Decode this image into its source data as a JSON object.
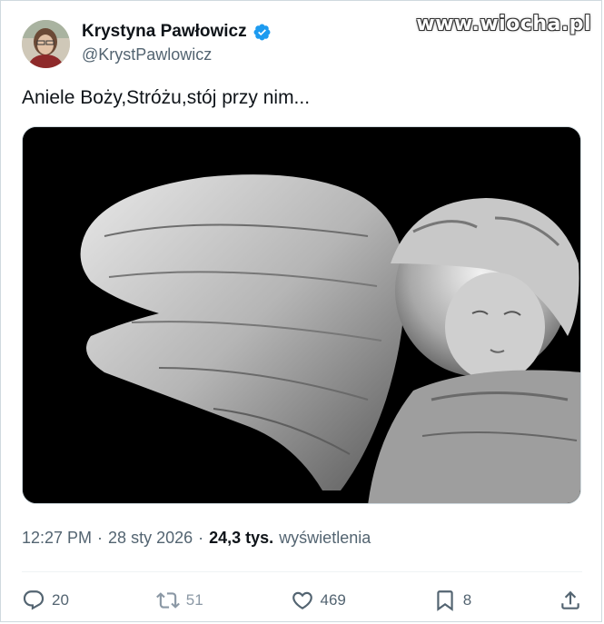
{
  "author": {
    "name": "Krystyna Pawłowicz",
    "handle": "@KrystPawlowicz",
    "verified": true
  },
  "watermark": "www.wiocha.pl",
  "tweet": {
    "text": "Aniele Boży,Stróżu,stój przy nim..."
  },
  "meta": {
    "time": "12:27 PM",
    "sep1": "·",
    "date": "28 sty 2026",
    "sep2": "·",
    "views_count": "24,3 tys.",
    "views_label": "wyświetlenia"
  },
  "actions": {
    "replies": "20",
    "reposts": "51",
    "likes": "469",
    "bookmarks": "8"
  },
  "colors": {
    "verified": "#1d9bf0",
    "text_primary": "#0f1419",
    "text_secondary": "#536471"
  },
  "icons": {
    "verified": "verified-badge-icon",
    "reply": "reply-icon",
    "repost": "repost-icon",
    "like": "heart-icon",
    "bookmark": "bookmark-icon",
    "share": "share-icon"
  }
}
